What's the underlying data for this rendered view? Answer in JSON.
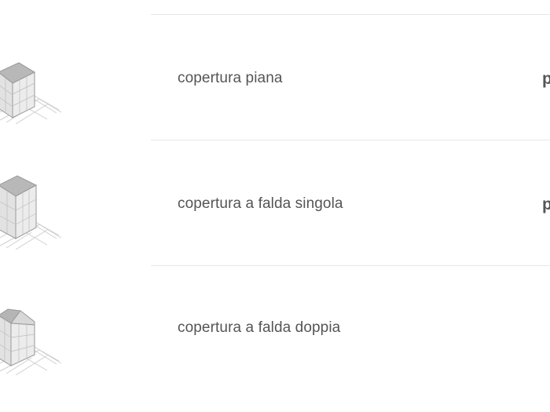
{
  "roof_options": [
    {
      "label": "copertura piana",
      "trailing": "p",
      "icon": "flat-roof-house-icon"
    },
    {
      "label": "copertura a falda singola",
      "trailing": "p",
      "icon": "single-pitch-roof-house-icon"
    },
    {
      "label": "copertura a falda doppia",
      "trailing": "",
      "icon": "gable-roof-house-icon"
    }
  ],
  "colors": {
    "text": "#555555",
    "divider": "#e7e7e7",
    "icon_stroke": "#9a9a9a",
    "icon_face": "#e0e0e0",
    "icon_roof": "#b5b5b5"
  }
}
